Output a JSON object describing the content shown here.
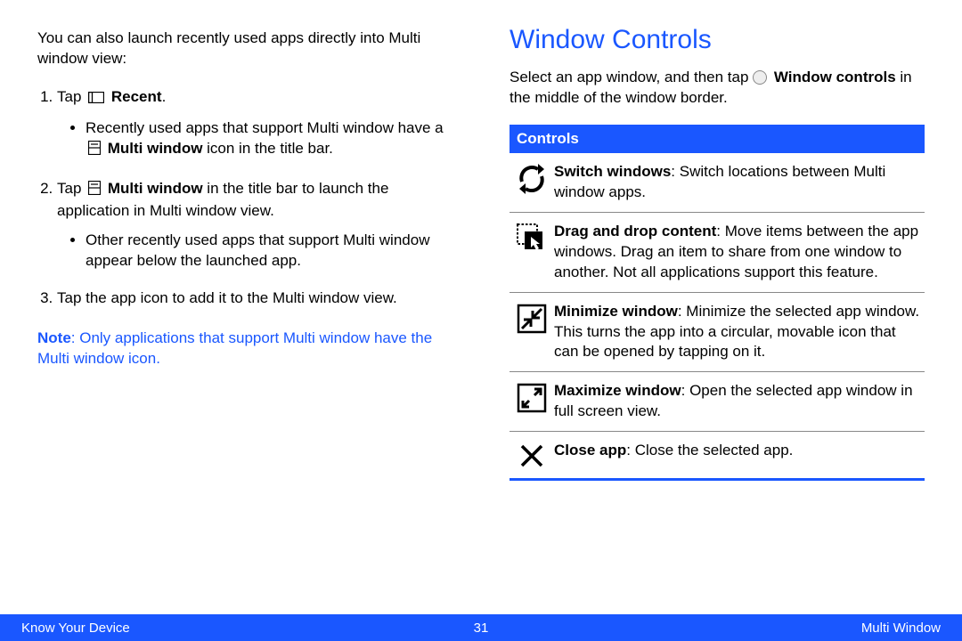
{
  "left": {
    "intro": "You can also launch recently used apps directly into Multi window view:",
    "step1_prefix": "Tap ",
    "step1_bold": " Recent",
    "step1_suffix": ".",
    "step1_bullet_a": "Recently used apps that support Multi window have a ",
    "step1_bullet_b": " Multi window",
    "step1_bullet_c": " icon in the title bar.",
    "step2_prefix": "Tap ",
    "step2_bold": " Multi window",
    "step2_suffix": " in the title bar to launch the application in Multi window view.",
    "step2_bullet": "Other recently used apps that support Multi window appear below the launched app.",
    "step3": "Tap the app icon to add it to the Multi window view.",
    "note_label": "Note",
    "note_text": ": Only applications that support Multi window have the Multi window icon."
  },
  "right": {
    "heading": "Window Controls",
    "intro_a": "Select an app window, and then tap ",
    "intro_bold": " Window controls",
    "intro_b": " in the middle of the window border.",
    "bar": "Controls",
    "rows": [
      {
        "title": "Switch windows",
        "body": ": Switch locations between Multi window apps."
      },
      {
        "title": "Drag and drop content",
        "body": ": Move items between the app windows. Drag an item to share from one window to another. Not all applications support this feature."
      },
      {
        "title": "Minimize window",
        "body": ": Minimize the selected app window. This turns the app into a circular, movable icon that can be opened by tapping on it."
      },
      {
        "title": "Maximize window",
        "body": ": Open the selected app window in full screen view."
      },
      {
        "title": "Close app",
        "body": ": Close the selected app."
      }
    ]
  },
  "footer": {
    "left": "Know Your Device",
    "center": "31",
    "right": "Multi Window"
  }
}
